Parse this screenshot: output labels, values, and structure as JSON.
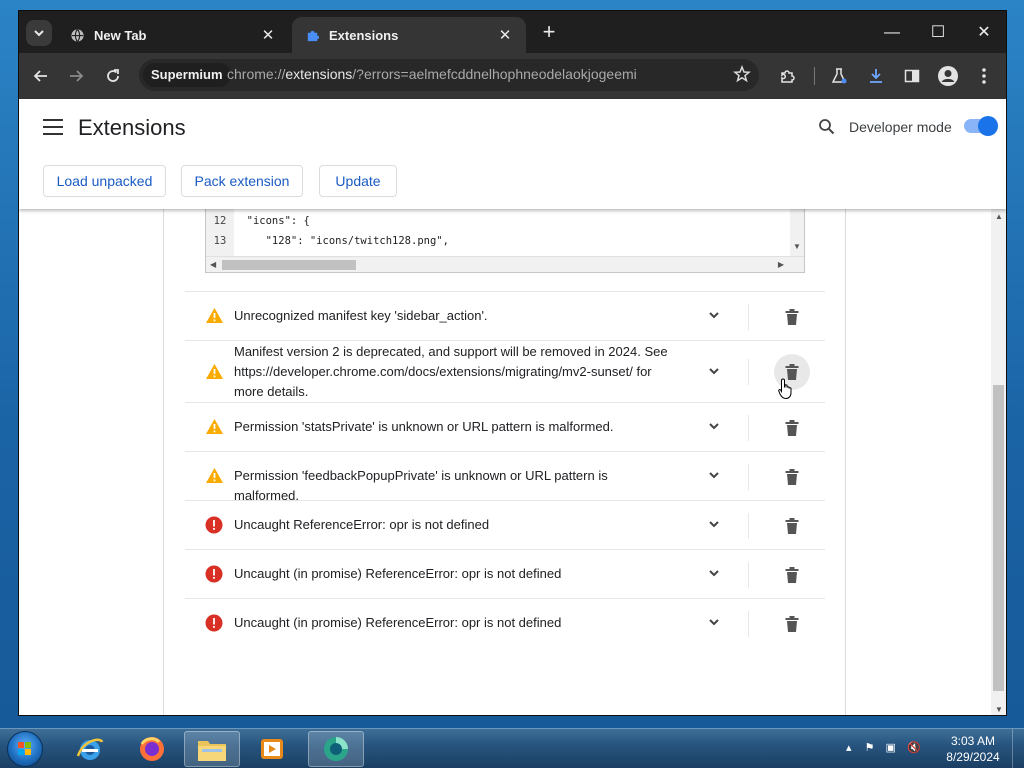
{
  "browser": {
    "tabs": [
      {
        "title": "New Tab",
        "close": "✕"
      },
      {
        "title": "Extensions",
        "close": "✕"
      }
    ],
    "new_tab": "+",
    "window_controls": {
      "minimize": "—",
      "maximize": "☐",
      "close": "✕"
    },
    "profile_chip": "Supermium",
    "url": {
      "prefix": "chrome://",
      "host": "extensions",
      "rest": "/?errors=aelmefcddnelhophneodelaokjogeemi"
    }
  },
  "header": {
    "title": "Extensions",
    "developer_mode_label": "Developer mode",
    "developer_mode_on": true,
    "buttons": {
      "load_unpacked": "Load unpacked",
      "pack_extension": "Pack extension",
      "update": "Update"
    }
  },
  "code_viewer": {
    "lines": [
      {
        "number": "12",
        "text": "  \"icons\": {"
      },
      {
        "number": "13",
        "text": "     \"128\": \"icons/twitch128.png\","
      }
    ]
  },
  "errors": [
    {
      "severity": "warning",
      "message": "Unrecognized manifest key 'sidebar_action'."
    },
    {
      "severity": "warning",
      "message": "Manifest version 2 is deprecated, and support will be removed in 2024. See https://developer.chrome.com/docs/extensions/migrating/mv2-sunset/ for more details."
    },
    {
      "severity": "warning",
      "message": "Permission 'statsPrivate' is unknown or URL pattern is malformed."
    },
    {
      "severity": "warning",
      "message": "Permission 'feedbackPopupPrivate' is unknown or URL pattern is malformed."
    },
    {
      "severity": "error",
      "message": "Uncaught ReferenceError: opr is not defined"
    },
    {
      "severity": "error",
      "message": "Uncaught (in promise) ReferenceError: opr is not defined"
    },
    {
      "severity": "error",
      "message": "Uncaught (in promise) ReferenceError: opr is not defined"
    }
  ],
  "colors": {
    "warning": "#f9ab00",
    "error": "#d93025",
    "accent": "#1a73e8"
  },
  "taskbar": {
    "apps": [
      "internet-explorer",
      "firefox",
      "file-explorer",
      "media-player",
      "supermium"
    ],
    "clock": {
      "time": "3:03 AM",
      "date": "8/29/2024"
    }
  }
}
